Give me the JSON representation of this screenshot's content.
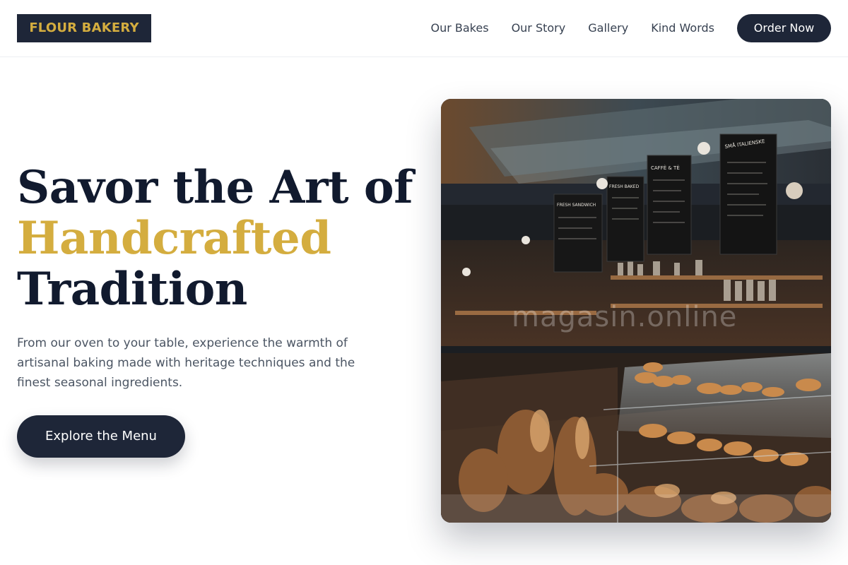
{
  "brand": {
    "logo_text": "FLOUR BAKERY",
    "primary_color": "#1e2638",
    "accent_color": "#d4ad3f"
  },
  "nav": {
    "links": [
      "Our Bakes",
      "Our Story",
      "Gallery",
      "Kind Words"
    ],
    "cta_label": "Order Now"
  },
  "hero": {
    "title_line1": "Savor the Art of",
    "title_line2": "Handcrafted",
    "title_line3": "Tradition",
    "description": "From our oven to your table, experience the warmth of artisanal baking made with heritage techniques and the finest seasonal ingredients.",
    "button_label": "Explore the Menu",
    "image_watermark": "magasin.online",
    "chalkboards": [
      "SMÅ ITALIENSKE",
      "CAFFÈ & TÈ",
      "FRESH BAKED",
      "FRESH SANDWICH"
    ]
  }
}
